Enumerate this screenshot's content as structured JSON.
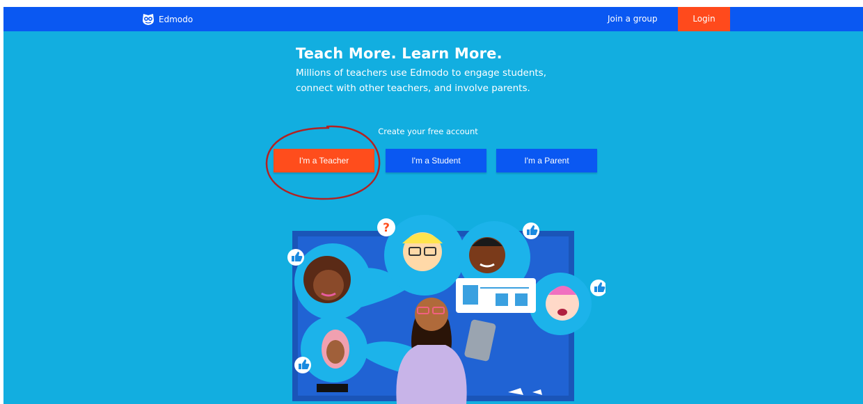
{
  "header": {
    "brand_name": "Edmodo",
    "logo_icon": "edmodo-owl-logo-icon",
    "join_label": "Join a group",
    "login_label": "Login"
  },
  "hero": {
    "headline": "Teach More. Learn More.",
    "tagline": "Millions of teachers use Edmodo to engage students, connect with other teachers, and involve parents."
  },
  "signup": {
    "create_label": "Create your free account",
    "teacher_label": "I'm a Teacher",
    "student_label": "I'm a Student",
    "parent_label": "I'm a Parent"
  },
  "colors": {
    "page_background": "#12aee0",
    "top_bar": "#0a58f2",
    "accent_orange": "#ff4d1c",
    "role_blue": "#0a58f2",
    "annotation_circle": "#b22222"
  },
  "illustration": {
    "icons": [
      "question-mark-icon",
      "thumbs-up-icon"
    ]
  }
}
